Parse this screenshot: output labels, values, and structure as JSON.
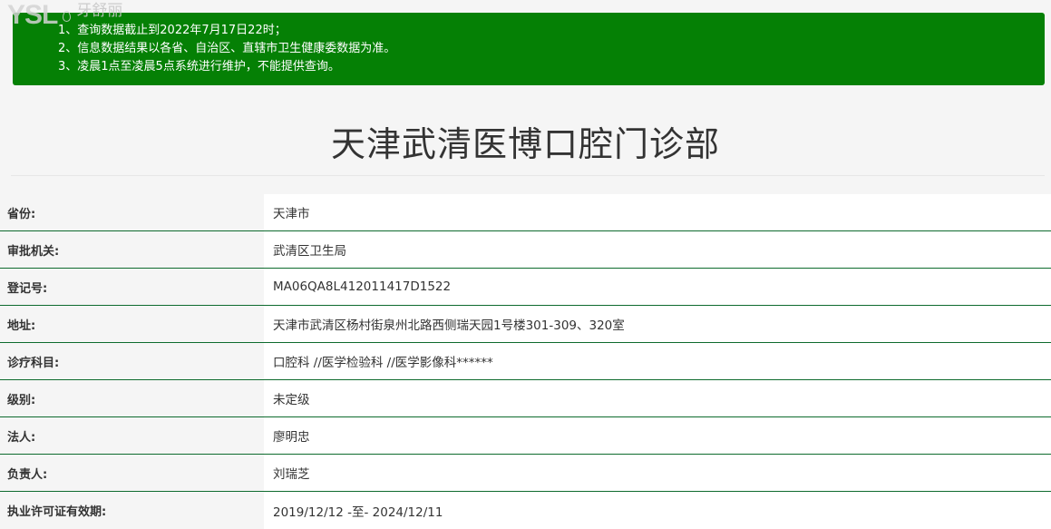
{
  "watermark": {
    "logo_text": "YSL",
    "brand_text": "牙舒丽"
  },
  "notice": {
    "lines": [
      "1、查询数据截止到2022年7月17日22时；",
      "2、信息数据结果以各省、自治区、直辖市卫生健康委数据为准。",
      "3、凌晨1点至凌晨5点系统进行维护，不能提供查询。"
    ],
    "background_color": "#058005"
  },
  "clinic": {
    "name": "天津武清医博口腔门诊部"
  },
  "details": [
    {
      "label": "省份:",
      "value": "天津市"
    },
    {
      "label": "审批机关:",
      "value": "武清区卫生局"
    },
    {
      "label": "登记号:",
      "value": "MA06QA8L412011417D1522"
    },
    {
      "label": "地址:",
      "value": "天津市武清区杨村街泉州北路西侧瑞天园1号楼301-309、320室"
    },
    {
      "label": "诊疗科目:",
      "value": "口腔科 //医学检验科 //医学影像科******"
    },
    {
      "label": "级别:",
      "value": "未定级"
    },
    {
      "label": "法人:",
      "value": "廖明忠"
    },
    {
      "label": "负责人:",
      "value": "刘瑞芝"
    },
    {
      "label": "执业许可证有效期:",
      "value": "2019/12/12 -至- 2024/12/11"
    }
  ],
  "colors": {
    "row_divider": "#0e6b2e",
    "label_bg": "#f5f5f5",
    "value_bg": "#ffffff"
  }
}
